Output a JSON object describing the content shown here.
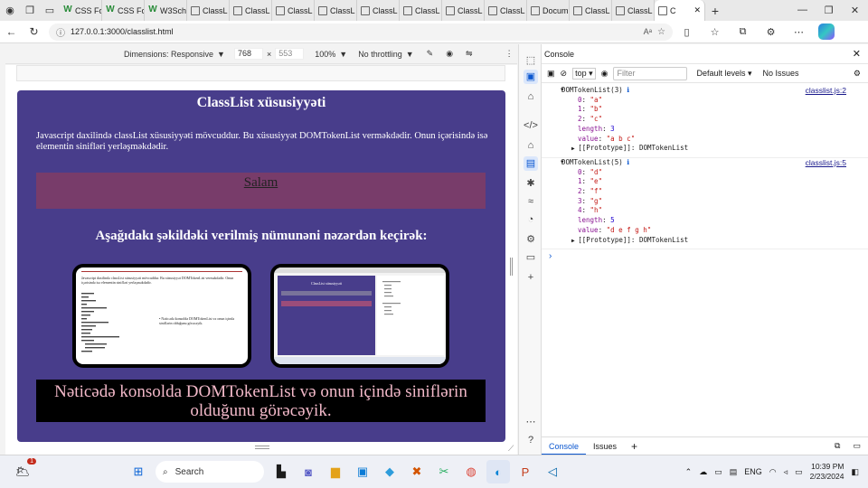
{
  "browser": {
    "tabs": [
      {
        "label": "CSS Fo",
        "favicon": "W"
      },
      {
        "label": "CSS Fo",
        "favicon": "W"
      },
      {
        "label": "W3Sch",
        "favicon": "W3"
      },
      {
        "label": "ClassL",
        "favicon": "page"
      },
      {
        "label": "ClassL",
        "favicon": "page"
      },
      {
        "label": "ClassL",
        "favicon": "page"
      },
      {
        "label": "ClassL",
        "favicon": "page"
      },
      {
        "label": "ClassL",
        "favicon": "page"
      },
      {
        "label": "ClassL",
        "favicon": "page"
      },
      {
        "label": "ClassL",
        "favicon": "page"
      },
      {
        "label": "ClassL",
        "favicon": "page"
      },
      {
        "label": "Docum",
        "favicon": "page"
      },
      {
        "label": "ClassL",
        "favicon": "page"
      },
      {
        "label": "ClassL",
        "favicon": "page"
      }
    ],
    "active_tab": "C",
    "url": "127.0.0.1:3000/classlist.html"
  },
  "device_toolbar": {
    "dimensions": "Dimensions: Responsive",
    "width": "768",
    "height": "553",
    "zoom": "100%",
    "throttle": "No throttling",
    "times": "×"
  },
  "page": {
    "title": "ClassList xüsusiyyəti",
    "intro": "Javascript daxilində classList xüsusiyyəti mövcuddur. Bu xüsusiyyət DOMTokenList verməkdədir. Onun içərisində isə elementin sinifləri yerləşməkdədir.",
    "salam": "Salam",
    "subtitle": "Aşağıdakı şəkildəki verilmiş nümunəni nəzərdən keçirək:",
    "result": "Nəticədə konsolda DOMTokenList və onun içində siniflərin olduğunu görəcəyik.",
    "thumb1_text": "Javascript daxilində classList xüsusiyyəti mövcuddur. Bu xüsusiyyət DOMTokenList verməkdədir. Onun içərisində isə elementin sinifləri yerləşməkdədir.",
    "thumb1_bullet": "Nəticədə konsolda DOMTokenList və onun içində siniflərin olduğunu görəcəyik.",
    "thumb2_title": "ClassList xüsusiyyəti"
  },
  "console": {
    "tab_label": "Console",
    "context": "top",
    "filter_placeholder": "Filter",
    "levels": "Default levels",
    "issues": "No Issues",
    "logs": [
      {
        "header": "DOMTokenList(3)",
        "source": "classlist.js:2",
        "items": [
          [
            "0",
            "\"a\""
          ],
          [
            "1",
            "\"b\""
          ],
          [
            "2",
            "\"c\""
          ]
        ],
        "length": "3",
        "value": "\"a b c\""
      },
      {
        "header": "DOMTokenList(5)",
        "source": "classlist.js:5",
        "items": [
          [
            "0",
            "\"d\""
          ],
          [
            "1",
            "\"e\""
          ],
          [
            "2",
            "\"f\""
          ],
          [
            "3",
            "\"g\""
          ],
          [
            "4",
            "\"h\""
          ]
        ],
        "length": "5",
        "value": "\"d e f g h\""
      }
    ],
    "prototype_label": "[[Prototype]]: DOMTokenList",
    "drawer_tabs": [
      "Console",
      "Issues"
    ]
  },
  "taskbar": {
    "search_label": "Search",
    "language": "ENG",
    "time": "10:39 PM",
    "date": "2/23/2024",
    "notification_count": "1"
  }
}
